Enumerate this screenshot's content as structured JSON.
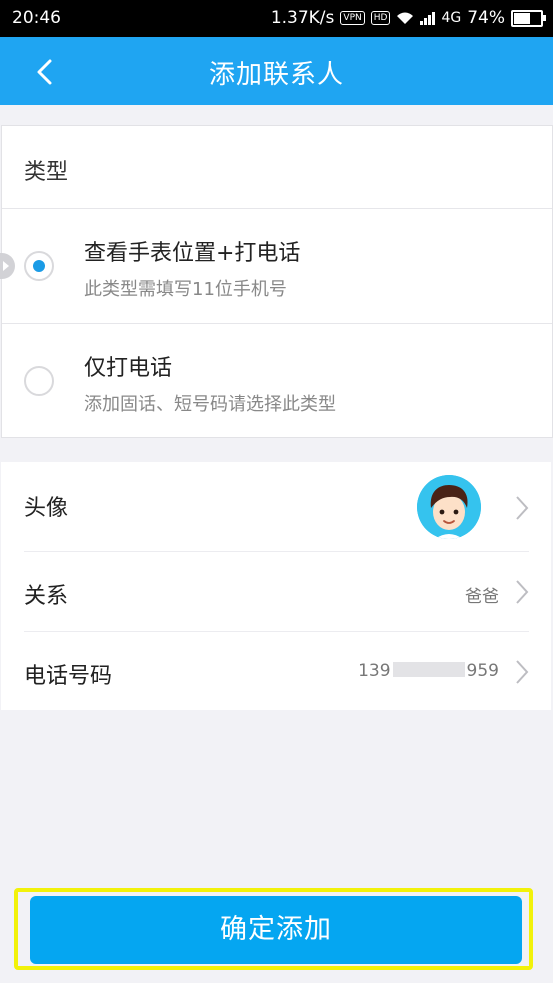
{
  "status_bar": {
    "time": "20:46",
    "speed": "1.37K/s",
    "vpn": "VPN",
    "hd": "HD",
    "network": "4G",
    "battery_text": "74%",
    "battery_level": 0.74
  },
  "nav": {
    "title": "添加联系人"
  },
  "type_section": {
    "heading": "类型",
    "options": [
      {
        "title": "查看手表位置+打电话",
        "subtitle": "此类型需填写11位手机号",
        "selected": true
      },
      {
        "title": "仅打电话",
        "subtitle": "添加固话、短号码请选择此类型",
        "selected": false
      }
    ]
  },
  "details": {
    "avatar_label": "头像",
    "relation_label": "关系",
    "relation_value": "爸爸",
    "phone_label": "电话号码",
    "phone_prefix": "139",
    "phone_suffix": "959"
  },
  "confirm_label": "确定添加",
  "colors": {
    "nav": "#1fa5f2",
    "button": "#05a6f1",
    "radio_selected": "#1a9be6",
    "highlight": "#f2f20a"
  }
}
